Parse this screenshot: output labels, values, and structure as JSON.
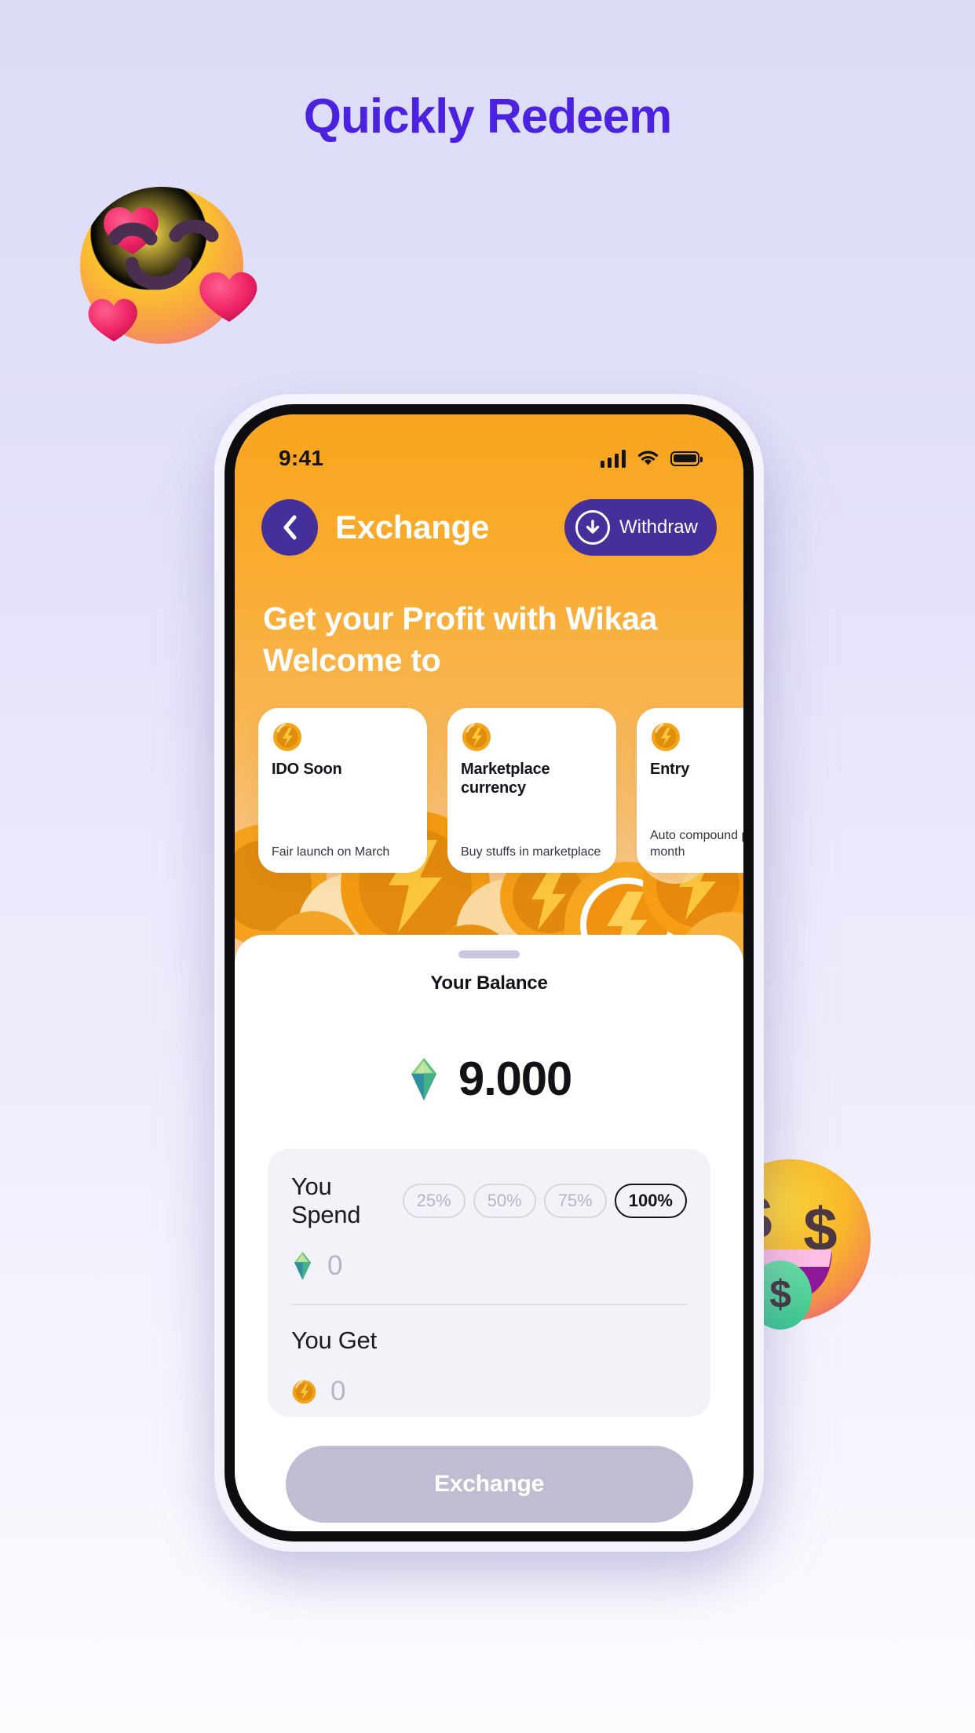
{
  "page": {
    "headline": "Quickly Redeem",
    "accent_color": "#4a22e0",
    "background_top": "#dcdcf7",
    "background_bottom": "#fcfcff"
  },
  "decorations": {
    "emoji_left": "smiling-face-with-hearts-emoji",
    "emoji_right": "money-mouth-face-emoji"
  },
  "phone": {
    "status_bar": {
      "time": "9:41",
      "cellular_icon": "signal-bars-icon",
      "wifi_icon": "wifi-icon",
      "battery_icon": "battery-full-icon"
    },
    "app_bar": {
      "back_icon": "chevron-left-icon",
      "title": "Exchange",
      "withdraw_label": "Withdraw",
      "withdraw_icon": "arrow-down-circle-icon",
      "button_color": "#45309b"
    },
    "hero": {
      "line1": "Get your Profit with Wikaa",
      "line2": "Welcome to",
      "gradient_top": "#f9a51f",
      "gradient_bottom": "#f6cb93"
    },
    "cards": [
      {
        "icon": "coin-icon",
        "title": "IDO Soon",
        "subtitle": "Fair launch\non March"
      },
      {
        "icon": "coin-icon",
        "title": "Marketplace\ncurrency",
        "subtitle": "Buy stuffs in\nmarketplace"
      },
      {
        "icon": "coin-icon",
        "title": "Entry",
        "subtitle": "Auto compound\nper month"
      }
    ],
    "sheet": {
      "grabber": "drag-handle",
      "balance_label": "Your Balance",
      "balance_icon": "gem-icon",
      "balance_amount": "9.000",
      "spend": {
        "title": "You Spend",
        "icon": "gem-icon",
        "value": "0",
        "chips": [
          {
            "label": "25%",
            "active": false
          },
          {
            "label": "50%",
            "active": false
          },
          {
            "label": "75%",
            "active": false
          },
          {
            "label": "100%",
            "active": true
          }
        ]
      },
      "get": {
        "title": "You Get",
        "icon": "coin-icon",
        "value": "0"
      },
      "cta_label": "Exchange",
      "cta_color": "#bfbdd2"
    }
  }
}
